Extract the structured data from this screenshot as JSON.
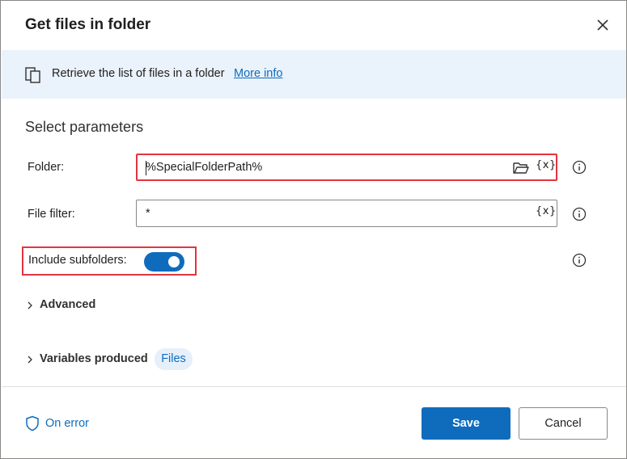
{
  "dialog": {
    "title": "Get files in folder",
    "close_icon": "close-icon"
  },
  "banner": {
    "icon": "document-info-icon",
    "text": "Retrieve the list of files in a folder",
    "link": "More info"
  },
  "parameters": {
    "section_title": "Select parameters",
    "folder": {
      "label": "Folder:",
      "value": "%SpecialFolderPath%",
      "browse_icon": "folder-open-icon",
      "variable_button": "{x}"
    },
    "file_filter": {
      "label": "File filter:",
      "value": "*",
      "variable_button": "{x}"
    },
    "include_subfolders": {
      "label": "Include subfolders:",
      "enabled": true
    },
    "advanced": {
      "label": "Advanced"
    },
    "variables_produced": {
      "label": "Variables produced",
      "variables": [
        "Files"
      ]
    }
  },
  "footer": {
    "on_error": "On error",
    "save": "Save",
    "cancel": "Cancel"
  },
  "colors": {
    "accent": "#0f6cbd",
    "banner_bg": "#eaf2fb",
    "highlight": "#e3343f"
  }
}
